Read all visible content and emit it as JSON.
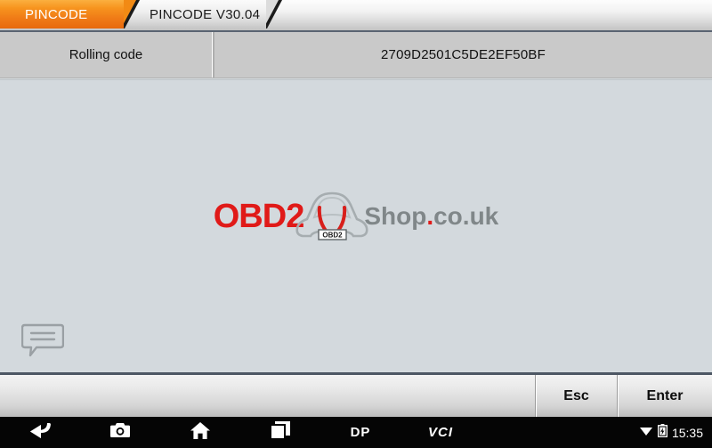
{
  "tabs": [
    {
      "label": "PINCODE",
      "active": true
    },
    {
      "label": "PINCODE V30.04",
      "active": false
    }
  ],
  "code_row": {
    "label": "Rolling code",
    "value": "2709D2501C5DE2EF50BF"
  },
  "content": {
    "watermark": {
      "brand": "OBD2",
      "shop": "Shop",
      "dot": ".",
      "tld": "co.uk",
      "plate": "OBD2"
    },
    "chat_icon": "message-bubble-icon"
  },
  "buttons": {
    "esc": "Esc",
    "enter": "Enter"
  },
  "navbar": {
    "back": "back-icon",
    "camera": "camera-icon",
    "home": "home-icon",
    "recents": "recent-apps-icon",
    "dp_logo": "DP",
    "vci": "VCI",
    "wifi": "wifi-icon",
    "battery": "battery-icon",
    "time": "15:35"
  },
  "colors": {
    "accent_orange": "#f7941e",
    "watermark_red": "#e01a18",
    "watermark_gray": "#808789",
    "content_bg": "#d3d9dd",
    "navbar_bg": "#050505"
  }
}
